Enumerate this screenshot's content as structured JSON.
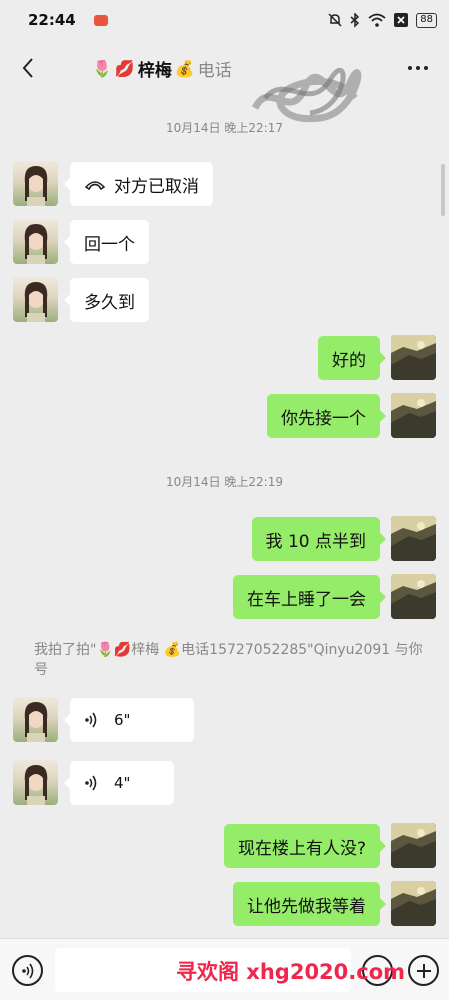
{
  "status_bar": {
    "time": "22:44",
    "battery": "88"
  },
  "header": {
    "title_emoji_1": "🌷",
    "title_emoji_2": "💋",
    "title_name": "梓梅",
    "title_emoji_3": "💰",
    "title_suffix": "电话"
  },
  "messages": {
    "ts1": "10月14日 晚上22:17",
    "m1": "对方已取消",
    "m2": "回一个",
    "m3": "多久到",
    "m4": "好的",
    "m5": "你先接一个",
    "ts2": "10月14日 晚上22:19",
    "m6": "我 10 点半到",
    "m7": "在车上睡了一会",
    "system": "我拍了拍\"🌷💋梓梅 💰电话15727052285\"Qinyu2091 与你号",
    "v1": "6\"",
    "v2": "4\"",
    "m8": "现在楼上有人没?",
    "m9": "让他先做我等着"
  },
  "input": {
    "placeholder": ""
  },
  "watermark": "寻欢阁 xhg2020.com",
  "colors": {
    "background": "#ededed",
    "bubble_right": "#95ec69",
    "bubble_left": "#ffffff",
    "watermark": "#f0264c"
  }
}
